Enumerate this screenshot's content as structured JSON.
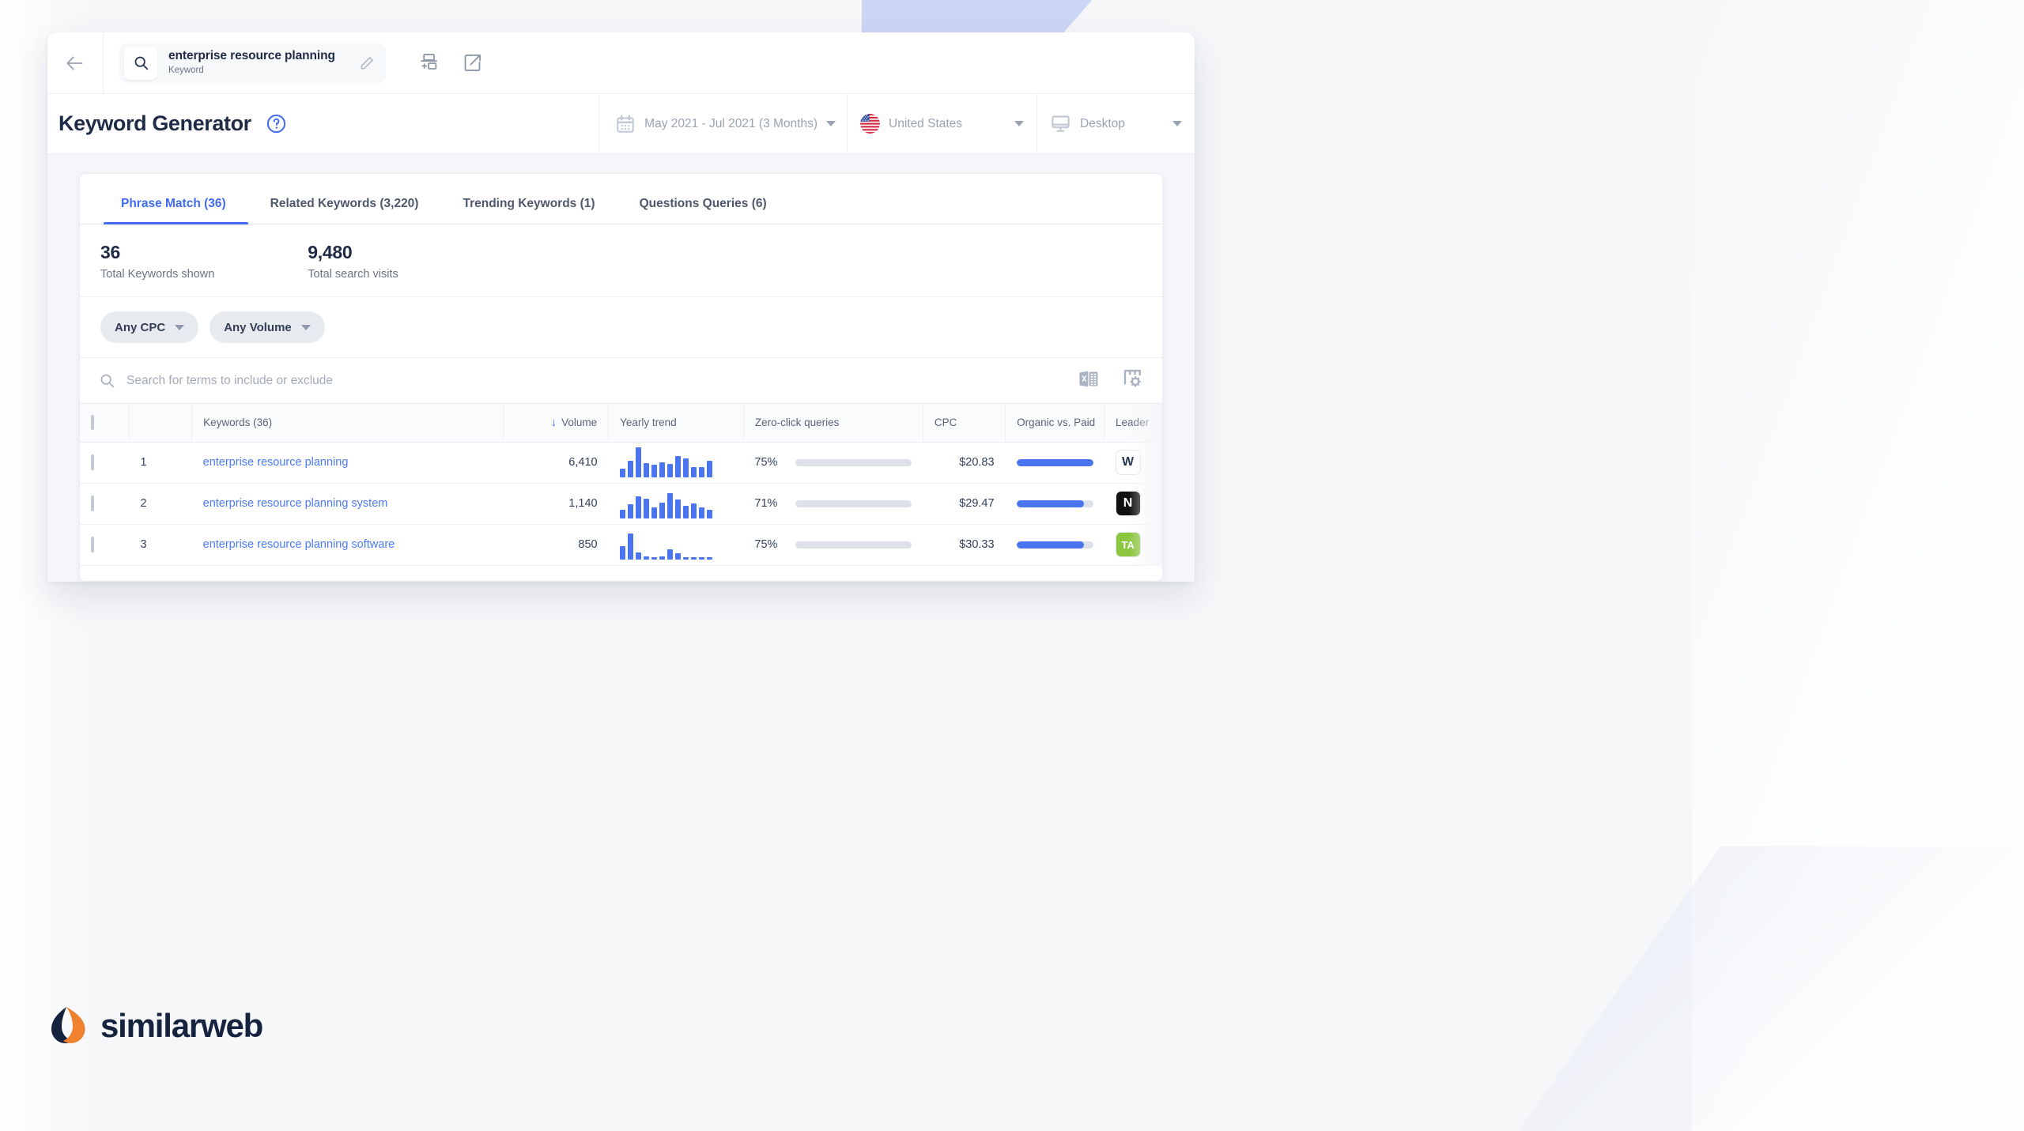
{
  "topbar": {
    "back_icon": "arrow-left-icon",
    "search_icon": "search-icon",
    "entity_title": "enterprise resource planning",
    "entity_subtitle": "Keyword",
    "edit_icon": "pencil-icon",
    "compare_icon": "add-to-compare-icon",
    "open_icon": "open-external-icon"
  },
  "header": {
    "page_title": "Keyword Generator",
    "help_icon": "question-circle-icon",
    "date_filter": {
      "icon": "calendar-icon",
      "label": "May 2021 - Jul 2021 (3 Months)"
    },
    "country_filter": {
      "icon": "us-flag-icon",
      "label": "United States"
    },
    "device_filter": {
      "icon": "desktop-icon",
      "label": "Desktop"
    }
  },
  "tabs": [
    {
      "label": "Phrase Match (36)",
      "active": true
    },
    {
      "label": "Related Keywords (3,220)",
      "active": false
    },
    {
      "label": "Trending Keywords (1)",
      "active": false
    },
    {
      "label": "Questions Queries (6)",
      "active": false
    }
  ],
  "stats": [
    {
      "value": "36",
      "label": "Total Keywords shown"
    },
    {
      "value": "9,480",
      "label": "Total search visits"
    }
  ],
  "chips": [
    {
      "label": "Any CPC"
    },
    {
      "label": "Any Volume"
    }
  ],
  "search": {
    "placeholder": "Search for terms to include or exclude",
    "icon": "search-icon",
    "excel_icon": "excel-export-icon",
    "settings_icon": "table-settings-icon"
  },
  "table": {
    "columns": [
      {
        "key": "checkbox",
        "label": ""
      },
      {
        "key": "rank",
        "label": ""
      },
      {
        "key": "keyword",
        "label": "Keywords (36)"
      },
      {
        "key": "volume",
        "label": "Volume",
        "sorted": "desc"
      },
      {
        "key": "trend",
        "label": "Yearly trend"
      },
      {
        "key": "zero",
        "label": "Zero-click queries"
      },
      {
        "key": "cpc",
        "label": "CPC"
      },
      {
        "key": "ovp",
        "label": "Organic vs. Paid"
      },
      {
        "key": "leader",
        "label": "Leader"
      }
    ],
    "rows": [
      {
        "rank": "1",
        "keyword": "enterprise resource planning",
        "volume": "6,410",
        "trend": [
          30,
          55,
          100,
          48,
          42,
          50,
          44,
          72,
          62,
          34,
          33,
          56
        ],
        "zero_pct": "75%",
        "zero_value": 75,
        "cpc": "$20.83",
        "ovp_value": 100,
        "leader_icon": "wikipedia-icon",
        "leader_glyph": "W"
      },
      {
        "rank": "2",
        "keyword": "enterprise resource planning system",
        "volume": "1,140",
        "trend": [
          28,
          48,
          74,
          66,
          38,
          52,
          84,
          64,
          42,
          50,
          36,
          30
        ],
        "zero_pct": "71%",
        "zero_value": 71,
        "cpc": "$29.47",
        "ovp_value": 88,
        "leader_icon": "netsuite-icon",
        "leader_glyph": "N"
      },
      {
        "rank": "3",
        "keyword": "enterprise resource planning software",
        "volume": "850",
        "trend": [
          44,
          86,
          24,
          10,
          8,
          10,
          34,
          22,
          8,
          6,
          5,
          5
        ],
        "zero_pct": "75%",
        "zero_value": 75,
        "cpc": "$30.33",
        "ovp_value": 88,
        "leader_icon": "trustradius-icon",
        "leader_glyph": "TA"
      }
    ]
  },
  "brand": {
    "name": "similarweb",
    "accent": "#f0812f",
    "dark": "#16233f"
  },
  "colors": {
    "accent_blue": "#4a74f0",
    "tab_active": "#3f6bf0",
    "text_dark": "#1f2b46"
  }
}
